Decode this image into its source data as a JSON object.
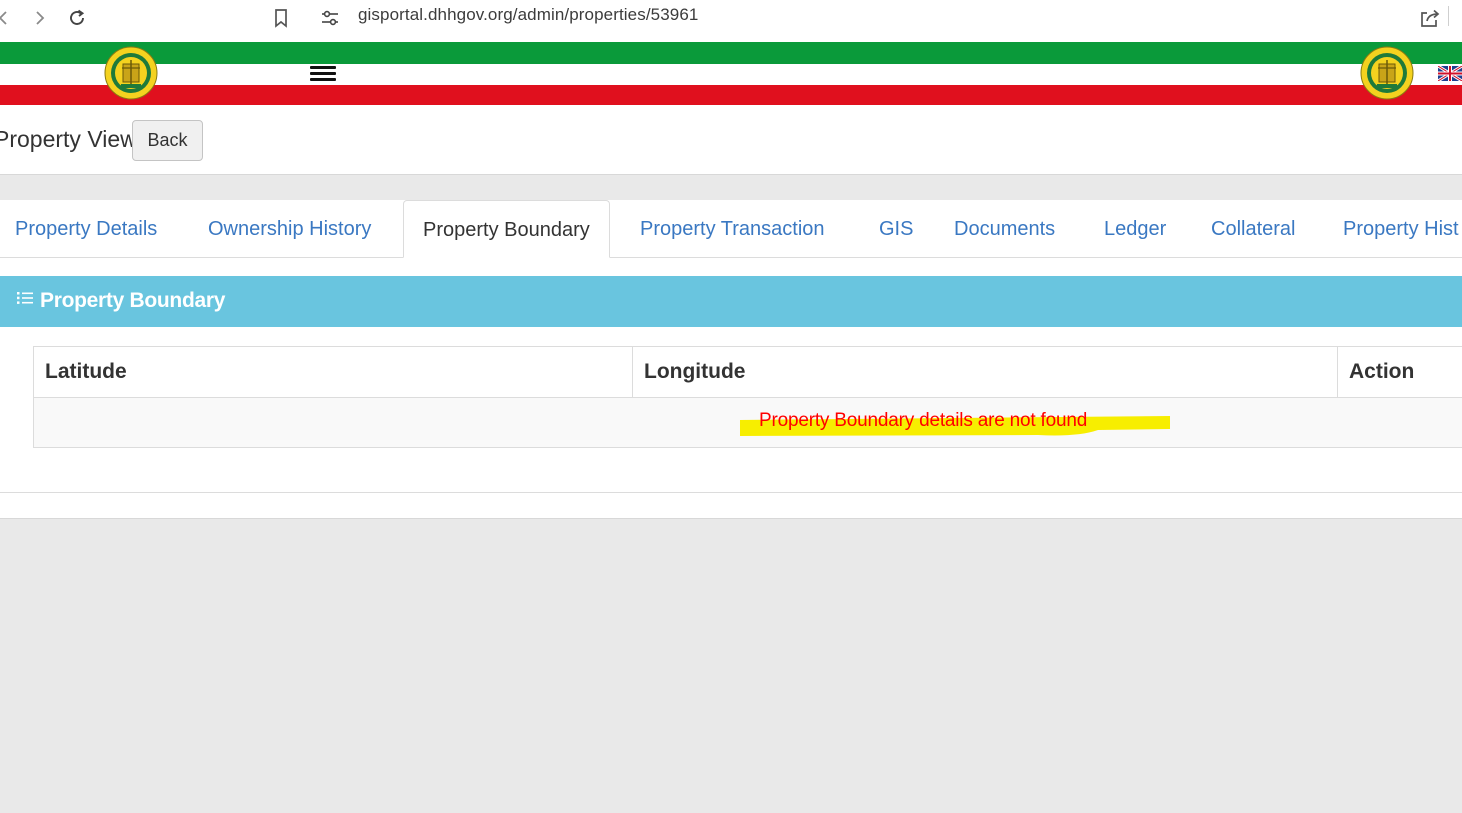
{
  "browser": {
    "url": "gisportal.dhhgov.org/admin/properties/53961"
  },
  "header": {
    "emblem_icon": "coat-of-arms-emblem",
    "menu_icon": "hamburger-menu-icon",
    "language_icon": "uk-flag-icon",
    "colors": {
      "green": "#0a9a3a",
      "white": "#ffffff",
      "red": "#e0101e"
    }
  },
  "page": {
    "title": "Property View",
    "back_label": "Back"
  },
  "tabs": [
    {
      "label": "Property Details",
      "active": false
    },
    {
      "label": "Ownership History",
      "active": false
    },
    {
      "label": "Property Boundary",
      "active": true
    },
    {
      "label": "Property Transaction",
      "active": false
    },
    {
      "label": "GIS",
      "active": false
    },
    {
      "label": "Documents",
      "active": false
    },
    {
      "label": "Ledger",
      "active": false
    },
    {
      "label": "Collateral",
      "active": false
    },
    {
      "label": "Property Hist",
      "active": false
    }
  ],
  "section": {
    "title": "Property Boundary",
    "icon": "list-icon",
    "color": "#69c5df"
  },
  "table": {
    "columns": [
      "Latitude",
      "Longitude",
      "Action"
    ],
    "empty_message": "Property Boundary details are not found",
    "empty_message_color": "#ff0000",
    "highlight_color": "#f7ee00"
  }
}
